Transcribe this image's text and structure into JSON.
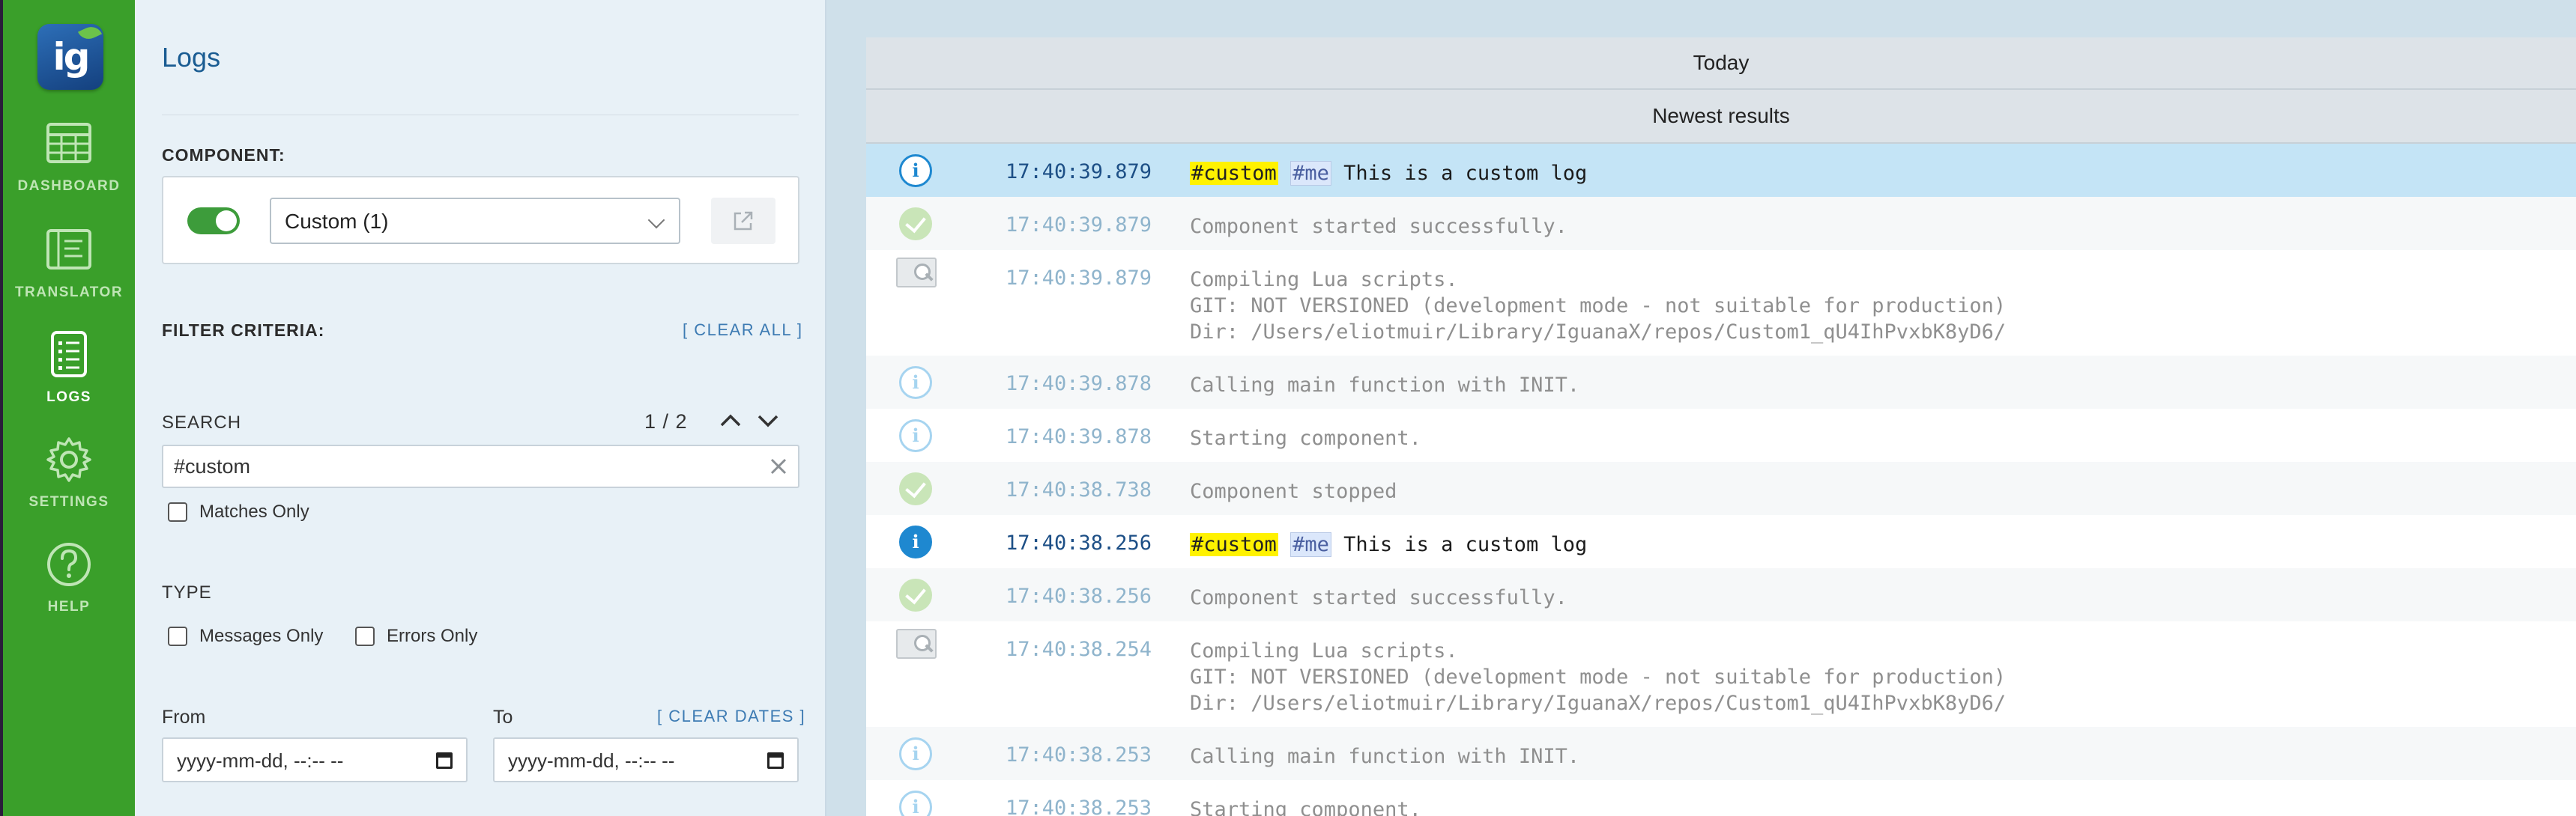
{
  "nav": {
    "logo_text": "ig",
    "items": [
      {
        "label": "DASHBOARD",
        "icon": "dashboard-grid-icon",
        "active": false
      },
      {
        "label": "TRANSLATOR",
        "icon": "translator-icon",
        "active": false
      },
      {
        "label": "LOGS",
        "icon": "logs-list-icon",
        "active": true
      },
      {
        "label": "SETTINGS",
        "icon": "gear-icon",
        "active": false
      },
      {
        "label": "HELP",
        "icon": "question-icon",
        "active": false
      }
    ]
  },
  "panel": {
    "title": "Logs",
    "component_label": "COMPONENT:",
    "component_enabled": true,
    "component_selected": "Custom (1)",
    "filter_label": "FILTER CRITERIA:",
    "clear_all": "[ CLEAR ALL ]",
    "search_label": "SEARCH",
    "search_count": "1 / 2",
    "search_value": "#custom",
    "matches_only": "Matches Only",
    "type_label": "TYPE",
    "messages_only": "Messages Only",
    "errors_only": "Errors Only",
    "from_label": "From",
    "to_label": "To",
    "clear_dates": "[ CLEAR DATES ]",
    "from_placeholder": "yyyy-mm-dd, --:-- --",
    "to_placeholder": "yyyy-mm-dd, --:-- --"
  },
  "viewer": {
    "group_header": "Today",
    "sub_header": "Newest results"
  },
  "logs": [
    {
      "type": "info-bold",
      "time": "17:40:39.879",
      "strong": true,
      "selected": true,
      "highlight": "#custom",
      "tag": "#me",
      "text": "This is a custom log"
    },
    {
      "type": "success",
      "time": "17:40:39.879",
      "text": "Component started successfully."
    },
    {
      "type": "debug",
      "time": "17:40:39.879",
      "text": "Compiling Lua scripts.\nGIT: NOT VERSIONED (development mode - not suitable for production)\nDir: /Users/eliotmuir/Library/IguanaX/repos/Custom1_qU4IhPvxbK8yD6/"
    },
    {
      "type": "info",
      "time": "17:40:39.878",
      "text": "Calling main function with INIT."
    },
    {
      "type": "info",
      "time": "17:40:39.878",
      "text": "Starting component."
    },
    {
      "type": "success",
      "time": "17:40:38.738",
      "text": "Component stopped"
    },
    {
      "type": "info-bold",
      "time": "17:40:38.256",
      "strong": true,
      "highlight": "#custom",
      "tag": "#me",
      "text": "This is a custom log"
    },
    {
      "type": "success",
      "time": "17:40:38.256",
      "text": "Component started successfully."
    },
    {
      "type": "debug",
      "time": "17:40:38.254",
      "text": "Compiling Lua scripts.\nGIT: NOT VERSIONED (development mode - not suitable for production)\nDir: /Users/eliotmuir/Library/IguanaX/repos/Custom1_qU4IhPvxbK8yD6/"
    },
    {
      "type": "info",
      "time": "17:40:38.253",
      "text": "Calling main function with INIT."
    },
    {
      "type": "info",
      "time": "17:40:38.253",
      "text": "Starting component."
    }
  ],
  "colors": {
    "rail": "#3a9f2a",
    "accent": "#1a5c92",
    "selected_row": "#c4e4f6",
    "highlight": "#fff200"
  }
}
